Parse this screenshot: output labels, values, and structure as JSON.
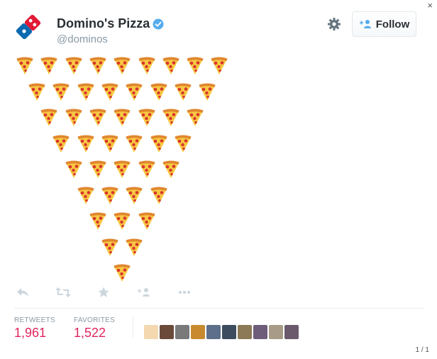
{
  "tweet": {
    "display_name": "Domino's Pizza",
    "handle": "@dominos",
    "verified": true,
    "avatar_icon": "dominos-logo-icon",
    "follow_label": "Follow",
    "content_emoji": "pizza",
    "pizza_rows": [
      9,
      8,
      7,
      6,
      5,
      4,
      3,
      2,
      1
    ]
  },
  "actions": [
    {
      "name": "reply-icon"
    },
    {
      "name": "retweet-icon"
    },
    {
      "name": "favorite-icon"
    },
    {
      "name": "follow-icon"
    },
    {
      "name": "more-icon"
    }
  ],
  "stats": {
    "retweets_label": "RETWEETS",
    "retweets_value": "1,961",
    "favorites_label": "FAVORITES",
    "favorites_value": "1,522"
  },
  "favoriters": [
    {
      "name": "favoriter-avatar",
      "color": "#f3d8b0"
    },
    {
      "name": "favoriter-avatar",
      "color": "#6b4a3a"
    },
    {
      "name": "favoriter-avatar",
      "color": "#7a7a7a"
    },
    {
      "name": "favoriter-avatar",
      "color": "#c98a2f"
    },
    {
      "name": "favoriter-avatar",
      "color": "#5d6f8a"
    },
    {
      "name": "favoriter-avatar",
      "color": "#3d4c5e"
    },
    {
      "name": "favoriter-avatar",
      "color": "#8b7a55"
    },
    {
      "name": "favoriter-avatar",
      "color": "#6d5c7a"
    },
    {
      "name": "favoriter-avatar",
      "color": "#a89b88"
    },
    {
      "name": "favoriter-avatar",
      "color": "#6a5a6b"
    }
  ],
  "colors": {
    "accent": "#55acee",
    "stat_value": "#e0245e",
    "verified": "#55acee"
  },
  "pager": "1 / 1"
}
